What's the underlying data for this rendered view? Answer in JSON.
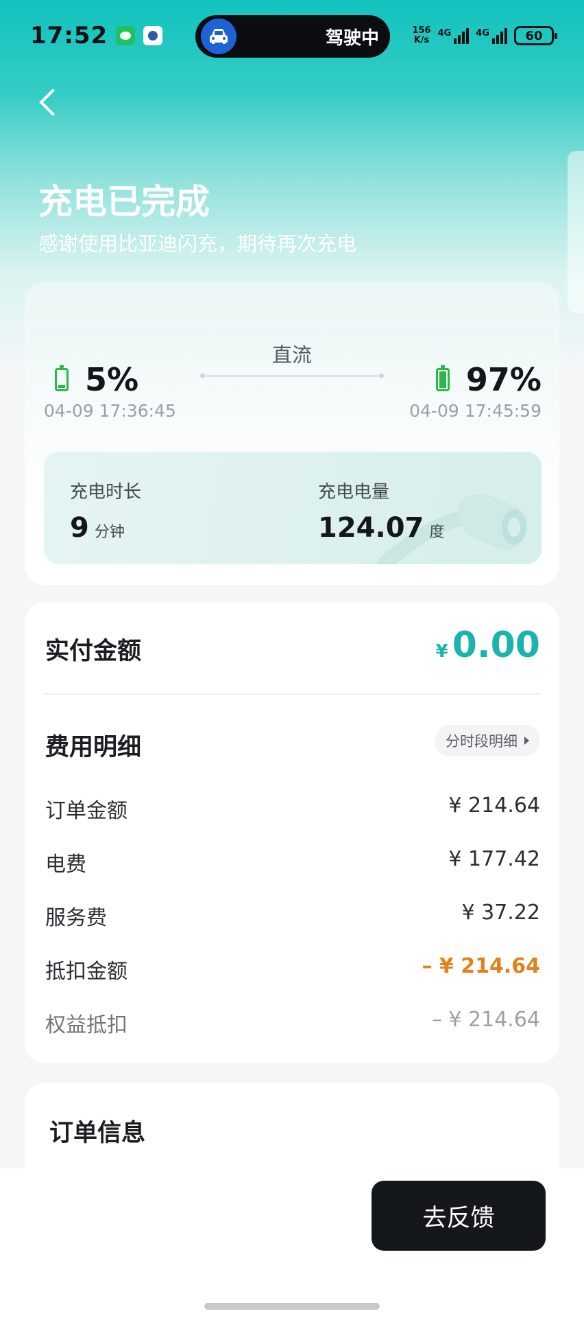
{
  "status_bar": {
    "time": "17:52",
    "island_text": "驾驶中",
    "net_speed_value": "156",
    "net_speed_unit": "K/s",
    "network_1": "4G",
    "network_2": "4G",
    "battery": "60"
  },
  "header": {
    "title": "充电已完成",
    "subtitle": "感谢使用比亚迪闪充，期待再次充电"
  },
  "charge": {
    "start_percent": "5%",
    "start_time": "04-09 17:36:45",
    "mode": "直流",
    "end_percent": "97%",
    "end_time": "04-09 17:45:59",
    "duration_label": "充电时长",
    "duration_value": "9",
    "duration_unit": "分钟",
    "energy_label": "充电电量",
    "energy_value": "124.07",
    "energy_unit": "度"
  },
  "payment": {
    "label": "实付金额",
    "currency": "¥",
    "amount": "0.00"
  },
  "fee_detail": {
    "title": "费用明细",
    "period_button": "分时段明细",
    "rows": [
      {
        "label": "订单金额",
        "value": "¥ 214.64"
      },
      {
        "label": "电费",
        "value": "¥ 177.42"
      },
      {
        "label": "服务费",
        "value": "¥ 37.22"
      },
      {
        "label": "抵扣金额",
        "value": "– ¥ 214.64"
      },
      {
        "label": "权益抵扣",
        "value": "– ¥ 214.64"
      }
    ]
  },
  "order_info": {
    "title": "订单信息"
  },
  "footer": {
    "feedback_button": "去反馈"
  },
  "colors": {
    "brand_teal": "#12c2bd",
    "amount_teal": "#1ab4ac",
    "deduction_orange": "#e0831e",
    "battery_green": "#2ab84a"
  }
}
